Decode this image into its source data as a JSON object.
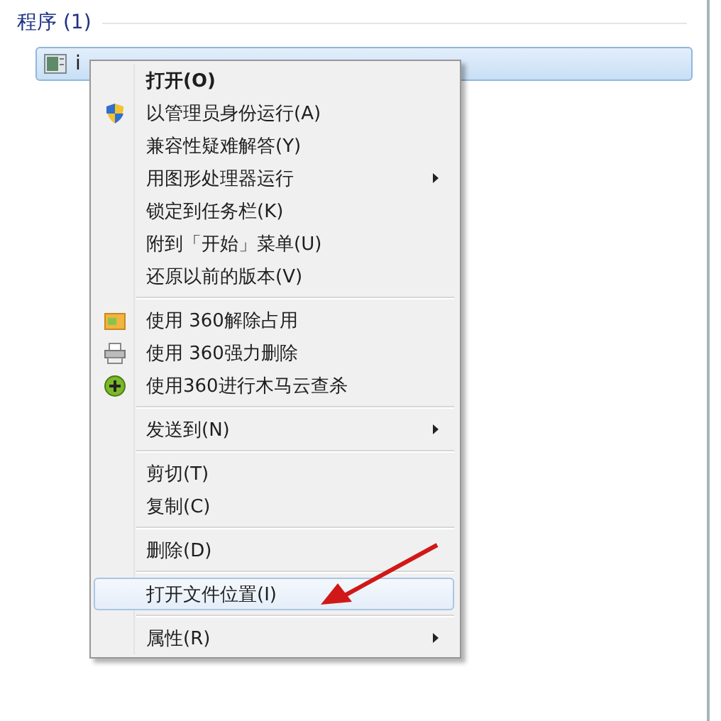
{
  "section": {
    "title": "程序 (1)"
  },
  "result": {
    "label": "i",
    "selected": true
  },
  "context_menu": {
    "items": [
      {
        "kind": "item",
        "label": "打开(O)",
        "bold": true,
        "submenu": false,
        "selected": false
      },
      {
        "kind": "item",
        "label": "以管理员身份运行(A)",
        "bold": false,
        "submenu": false,
        "selected": false
      },
      {
        "kind": "item",
        "label": "兼容性疑难解答(Y)",
        "bold": false,
        "submenu": false,
        "selected": false
      },
      {
        "kind": "item",
        "label": "用图形处理器运行",
        "bold": false,
        "submenu": true,
        "selected": false
      },
      {
        "kind": "item",
        "label": "锁定到任务栏(K)",
        "bold": false,
        "submenu": false,
        "selected": false
      },
      {
        "kind": "item",
        "label": "附到「开始」菜单(U)",
        "bold": false,
        "submenu": false,
        "selected": false
      },
      {
        "kind": "item",
        "label": "还原以前的版本(V)",
        "bold": false,
        "submenu": false,
        "selected": false
      },
      {
        "kind": "separator"
      },
      {
        "kind": "item",
        "label": "使用 360解除占用",
        "bold": false,
        "submenu": false,
        "selected": false
      },
      {
        "kind": "item",
        "label": "使用 360强力删除",
        "bold": false,
        "submenu": false,
        "selected": false
      },
      {
        "kind": "item",
        "label": "使用360进行木马云查杀",
        "bold": false,
        "submenu": false,
        "selected": false
      },
      {
        "kind": "separator"
      },
      {
        "kind": "item",
        "label": "发送到(N)",
        "bold": false,
        "submenu": true,
        "selected": false
      },
      {
        "kind": "separator"
      },
      {
        "kind": "item",
        "label": "剪切(T)",
        "bold": false,
        "submenu": false,
        "selected": false
      },
      {
        "kind": "item",
        "label": "复制(C)",
        "bold": false,
        "submenu": false,
        "selected": false
      },
      {
        "kind": "separator"
      },
      {
        "kind": "item",
        "label": "删除(D)",
        "bold": false,
        "submenu": false,
        "selected": false
      },
      {
        "kind": "separator"
      },
      {
        "kind": "item",
        "label": "打开文件位置(I)",
        "bold": false,
        "submenu": false,
        "selected": true
      },
      {
        "kind": "separator"
      },
      {
        "kind": "item",
        "label": "属性(R)",
        "bold": false,
        "submenu": true,
        "selected": false
      }
    ]
  }
}
